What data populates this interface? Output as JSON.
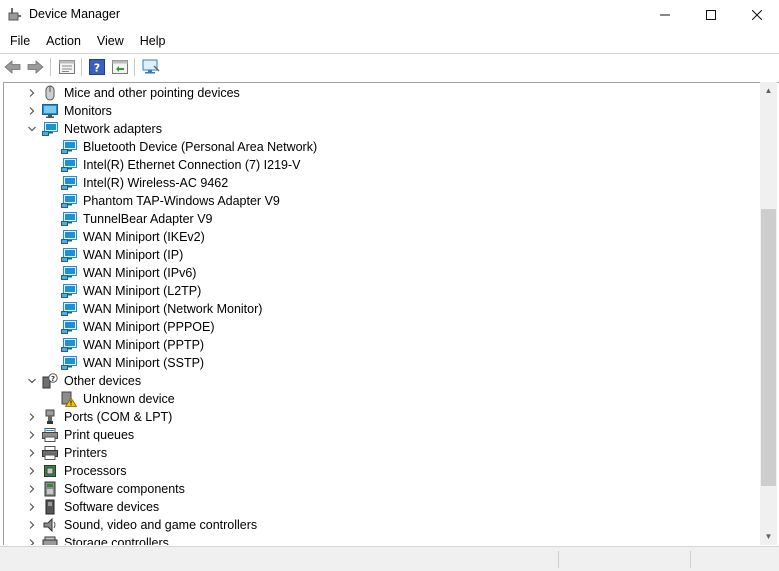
{
  "window": {
    "title": "Device Manager",
    "minimize": "—",
    "maximize": "☐",
    "close": "✕"
  },
  "menu": [
    "File",
    "Action",
    "View",
    "Help"
  ],
  "toolbar": {
    "buttons": [
      "back-arrow-icon",
      "forward-arrow-icon",
      "properties-icon",
      "help-icon",
      "update-driver-icon",
      "monitor-scan-icon"
    ]
  },
  "tree": {
    "rows": [
      {
        "label": "Mice and other pointing devices",
        "level": 0,
        "state": "collapsed",
        "icon": "mouse-icon"
      },
      {
        "label": "Monitors",
        "level": 0,
        "state": "collapsed",
        "icon": "monitor-icon"
      },
      {
        "label": "Network adapters",
        "level": 0,
        "state": "expanded",
        "icon": "network-adapter-icon"
      },
      {
        "label": "Bluetooth Device (Personal Area Network)",
        "level": 1,
        "icon": "network-adapter-icon"
      },
      {
        "label": "Intel(R) Ethernet Connection (7) I219-V",
        "level": 1,
        "icon": "network-adapter-icon"
      },
      {
        "label": "Intel(R) Wireless-AC 9462",
        "level": 1,
        "icon": "network-adapter-icon"
      },
      {
        "label": "Phantom TAP-Windows Adapter V9",
        "level": 1,
        "icon": "network-adapter-icon"
      },
      {
        "label": "TunnelBear Adapter V9",
        "level": 1,
        "icon": "network-adapter-icon"
      },
      {
        "label": "WAN Miniport (IKEv2)",
        "level": 1,
        "icon": "network-adapter-icon"
      },
      {
        "label": "WAN Miniport (IP)",
        "level": 1,
        "icon": "network-adapter-icon"
      },
      {
        "label": "WAN Miniport (IPv6)",
        "level": 1,
        "icon": "network-adapter-icon"
      },
      {
        "label": "WAN Miniport (L2TP)",
        "level": 1,
        "icon": "network-adapter-icon"
      },
      {
        "label": "WAN Miniport (Network Monitor)",
        "level": 1,
        "icon": "network-adapter-icon"
      },
      {
        "label": "WAN Miniport (PPPOE)",
        "level": 1,
        "icon": "network-adapter-icon"
      },
      {
        "label": "WAN Miniport (PPTP)",
        "level": 1,
        "icon": "network-adapter-icon"
      },
      {
        "label": "WAN Miniport (SSTP)",
        "level": 1,
        "icon": "network-adapter-icon"
      },
      {
        "label": "Other devices",
        "level": 0,
        "state": "expanded",
        "icon": "unknown-device-category-icon"
      },
      {
        "label": "Unknown device",
        "level": 1,
        "icon": "warning-device-icon"
      },
      {
        "label": "Ports (COM & LPT)",
        "level": 0,
        "state": "collapsed",
        "icon": "port-icon"
      },
      {
        "label": "Print queues",
        "level": 0,
        "state": "collapsed",
        "icon": "print-queue-icon"
      },
      {
        "label": "Printers",
        "level": 0,
        "state": "collapsed",
        "icon": "printer-icon"
      },
      {
        "label": "Processors",
        "level": 0,
        "state": "collapsed",
        "icon": "processor-icon"
      },
      {
        "label": "Software components",
        "level": 0,
        "state": "collapsed",
        "icon": "software-component-icon"
      },
      {
        "label": "Software devices",
        "level": 0,
        "state": "collapsed",
        "icon": "software-device-icon"
      },
      {
        "label": "Sound, video and game controllers",
        "level": 0,
        "state": "collapsed",
        "icon": "speaker-icon"
      },
      {
        "label": "Storage controllers",
        "level": 0,
        "state": "collapsed",
        "icon": "storage-controller-icon"
      }
    ]
  },
  "colors": {
    "network_blue": "#1e90d6",
    "warning_yellow": "#f5c400",
    "chevron": "#555555"
  }
}
